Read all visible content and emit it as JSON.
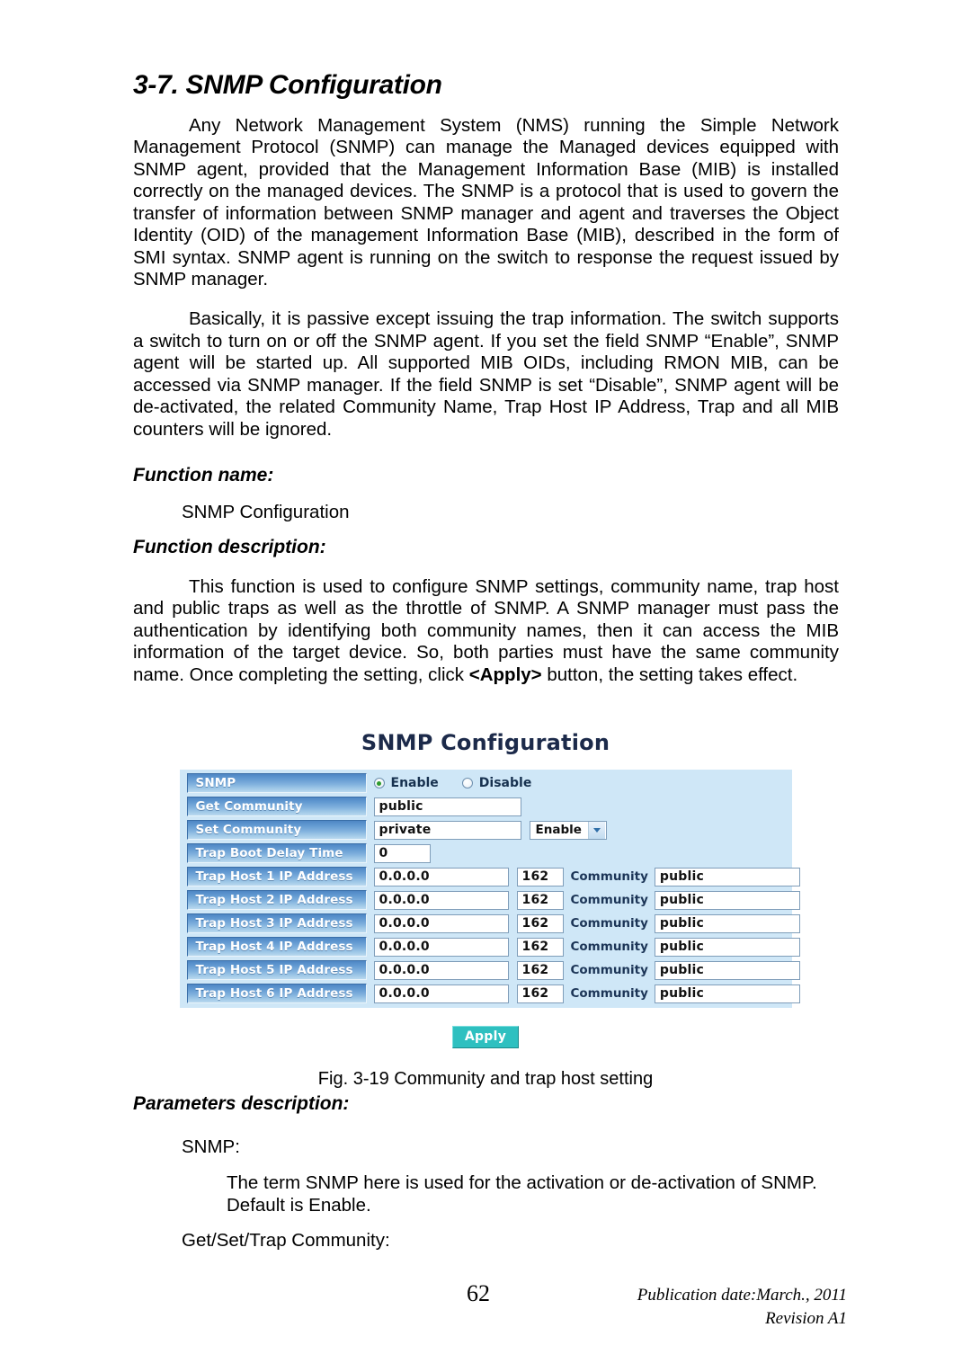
{
  "document": {
    "section_title": "3-7. SNMP Configuration",
    "paragraphs": [
      "Any Network Management System (NMS) running the Simple Network Management Protocol (SNMP) can manage the Managed devices equipped with SNMP agent, provided that the Management Information Base (MIB) is installed correctly on the managed devices. The SNMP is a protocol that is used to govern the transfer of information between SNMP manager and agent and traverses the Object Identity (OID) of the management Information Base (MIB), described in the form of SMI syntax. SNMP agent is running on the switch to response the request issued by SNMP manager.",
      "Basically, it is passive except issuing the trap information. The switch supports a switch to turn on or off the SNMP agent. If you set the field SNMP “Enable”, SNMP agent will be started up. All supported MIB OIDs, including RMON MIB, can be accessed via SNMP manager. If the field SNMP is set “Disable”, SNMP agent will be de-activated, the related Community Name, Trap Host IP Address, Trap and all MIB counters will be ignored."
    ],
    "function_name_heading": "Function name:",
    "function_name_value": "SNMP Configuration",
    "function_description_heading": "Function description:",
    "function_description_pre": "This function is used to configure SNMP settings, community name, trap host and public traps as well as the throttle of SNMP. A SNMP manager must pass the authentication by identifying both community names, then it can access the MIB information of the target device. So, both parties must have the same community name. Once completing the setting, click ",
    "function_description_bold": "<Apply>",
    "function_description_post": " button, the setting takes effect.",
    "parameters_description_heading": "Parameters description:",
    "param_snmp_label": "SNMP:",
    "param_snmp_text": "The term SNMP here is used for the activation or de-activation of SNMP. Default is Enable.",
    "param_community_label": "Get/Set/Trap Community:",
    "figure_caption": "Fig. 3-19 Community and trap host setting"
  },
  "panel": {
    "title": "SNMP Configuration",
    "snmp_row": {
      "label": "SNMP",
      "options": [
        {
          "label": "Enable",
          "selected": true
        },
        {
          "label": "Disable",
          "selected": false
        }
      ]
    },
    "get_community": {
      "label": "Get Community",
      "value": "public"
    },
    "set_community": {
      "label": "Set Community",
      "value": "private",
      "select_value": "Enable"
    },
    "trap_boot_delay": {
      "label": "Trap Boot Delay Time",
      "value": "0"
    },
    "community_field_label": "Community",
    "trap_hosts": [
      {
        "label": "Trap Host 1 IP Address",
        "ip": "0.0.0.0",
        "port": "162",
        "community": "public"
      },
      {
        "label": "Trap Host 2 IP Address",
        "ip": "0.0.0.0",
        "port": "162",
        "community": "public"
      },
      {
        "label": "Trap Host 3 IP Address",
        "ip": "0.0.0.0",
        "port": "162",
        "community": "public"
      },
      {
        "label": "Trap Host 4 IP Address",
        "ip": "0.0.0.0",
        "port": "162",
        "community": "public"
      },
      {
        "label": "Trap Host 5 IP Address",
        "ip": "0.0.0.0",
        "port": "162",
        "community": "public"
      },
      {
        "label": "Trap Host 6 IP Address",
        "ip": "0.0.0.0",
        "port": "162",
        "community": "public"
      }
    ],
    "apply_label": "Apply"
  },
  "footer": {
    "page_number": "62",
    "publication_date": "Publication date:March., 2011",
    "revision": "Revision A1"
  },
  "colors": {
    "panel_background": "#cfe7f7",
    "label_cell_blue": "#4e86c4",
    "apply_teal": "#2ec0c0",
    "radio_dot_green": "#2e9b2e",
    "panel_title_navy": "#1c2a4a"
  }
}
